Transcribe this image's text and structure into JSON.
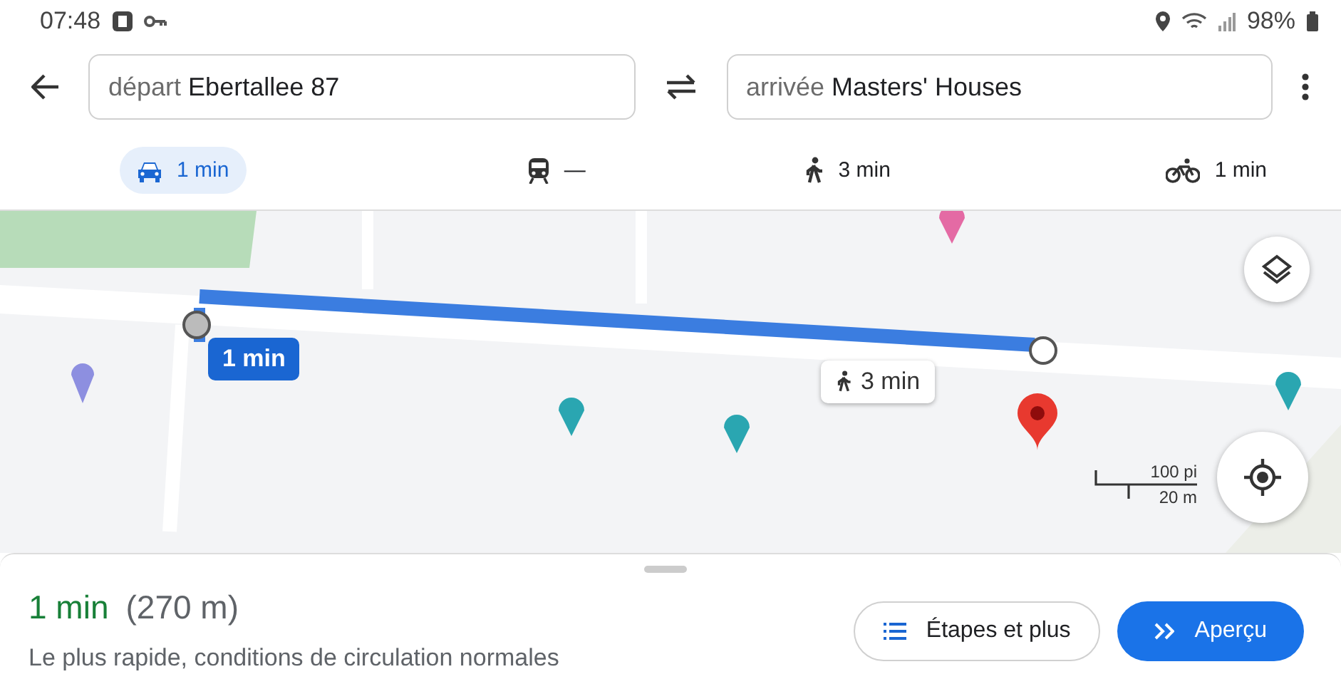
{
  "status_bar": {
    "time": "07:48",
    "battery": "98%"
  },
  "route": {
    "from_label": "départ",
    "from": "Ebertallee 87",
    "to_label": "arrivée",
    "to": "Masters' Houses"
  },
  "modes": [
    {
      "kind": "car",
      "label": "1 min",
      "selected": true
    },
    {
      "kind": "transit",
      "label": "—",
      "selected": false
    },
    {
      "kind": "walk",
      "label": "3 min",
      "selected": false
    },
    {
      "kind": "bike",
      "label": "1 min",
      "selected": false
    }
  ],
  "map": {
    "drive_bubble": "1 min",
    "walk_bubble": "3 min",
    "scale_top": "100 pi",
    "scale_bottom": "20 m"
  },
  "summary": {
    "duration": "1 min",
    "distance": "(270 m)",
    "description": "Le plus rapide, conditions de circulation normales"
  },
  "buttons": [
    {
      "kind": "steps",
      "label": "Étapes et plus"
    },
    {
      "kind": "preview",
      "label": "Aperçu"
    }
  ]
}
